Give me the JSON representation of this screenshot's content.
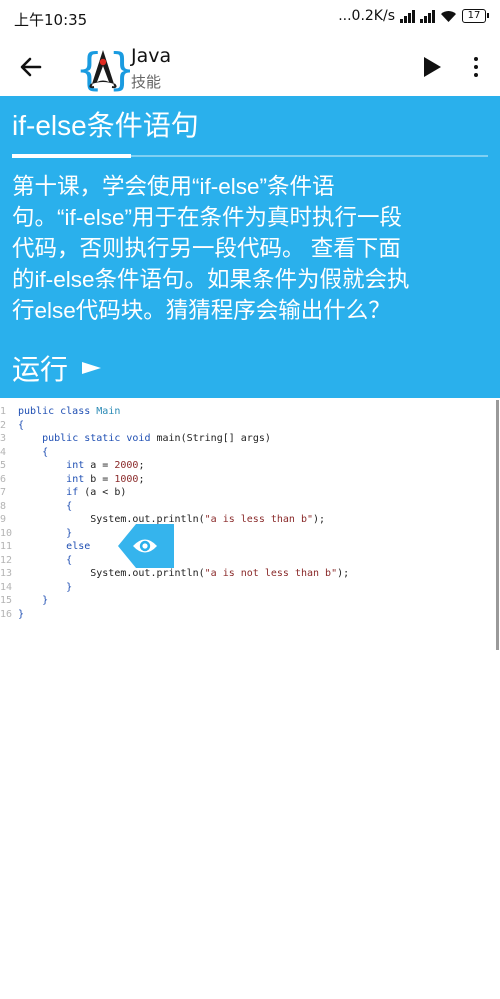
{
  "status_bar": {
    "time": "上午10:35",
    "network_speed": "...0.2K/s",
    "battery": "17"
  },
  "app_bar": {
    "title": "Java",
    "subtitle": "技能",
    "icons": {
      "back": "arrow-left-icon",
      "play": "play-icon",
      "more": "more-vert-icon",
      "logo": "java-duke-logo"
    }
  },
  "lesson": {
    "title": "if-else条件语句",
    "progress": 0.25,
    "lines": [
      "第十课，学会使用“if-else”条件语",
      "句。“if-else”用于在条件为真时执行一段",
      "代码，否则执行另一段代码。 查看下面",
      "的if-else条件语句。如果条件为假就会执",
      "行else代码块。猜猜程序会输出什么？"
    ],
    "run_label": "运行",
    "bg_color": "#2ab0ec"
  },
  "code": {
    "line_numbers": [
      "1",
      "2",
      "3",
      "4",
      "5",
      "6",
      "7",
      "8",
      "9",
      "10",
      "11",
      "12",
      "13",
      "14",
      "15",
      "16"
    ],
    "lines": [
      {
        "indent": "",
        "tokens": [
          {
            "t": "public class ",
            "c": "kw"
          },
          {
            "t": "Main",
            "c": "cls"
          }
        ]
      },
      {
        "indent": "",
        "tokens": [
          {
            "t": "{",
            "c": "kw"
          }
        ]
      },
      {
        "indent": "    ",
        "tokens": [
          {
            "t": "public static void ",
            "c": "kw"
          },
          {
            "t": "main(String[] args)",
            "c": ""
          }
        ]
      },
      {
        "indent": "    ",
        "tokens": [
          {
            "t": "{",
            "c": "kw"
          }
        ]
      },
      {
        "indent": "        ",
        "tokens": [
          {
            "t": "int ",
            "c": "kw"
          },
          {
            "t": "a = ",
            "c": ""
          },
          {
            "t": "2000",
            "c": "num"
          },
          {
            "t": ";",
            "c": ""
          }
        ]
      },
      {
        "indent": "        ",
        "tokens": [
          {
            "t": "int ",
            "c": "kw"
          },
          {
            "t": "b = ",
            "c": ""
          },
          {
            "t": "1000",
            "c": "num"
          },
          {
            "t": ";",
            "c": ""
          }
        ]
      },
      {
        "indent": "        ",
        "tokens": [
          {
            "t": "if ",
            "c": "kw"
          },
          {
            "t": "(a < b)",
            "c": ""
          }
        ]
      },
      {
        "indent": "        ",
        "tokens": [
          {
            "t": "{",
            "c": "kw"
          }
        ]
      },
      {
        "indent": "            ",
        "tokens": [
          {
            "t": "System.out.println(",
            "c": ""
          },
          {
            "t": "\"a is less than b\"",
            "c": "str"
          },
          {
            "t": ");",
            "c": ""
          }
        ]
      },
      {
        "indent": "        ",
        "tokens": [
          {
            "t": "}",
            "c": "kw"
          }
        ]
      },
      {
        "indent": "        ",
        "tokens": [
          {
            "t": "else",
            "c": "kw"
          }
        ]
      },
      {
        "indent": "        ",
        "tokens": [
          {
            "t": "{",
            "c": "kw"
          }
        ]
      },
      {
        "indent": "            ",
        "tokens": [
          {
            "t": "System.out.println(",
            "c": ""
          },
          {
            "t": "\"a is not less than b\"",
            "c": "str"
          },
          {
            "t": ");",
            "c": ""
          }
        ]
      },
      {
        "indent": "        ",
        "tokens": [
          {
            "t": "}",
            "c": "kw"
          }
        ]
      },
      {
        "indent": "    ",
        "tokens": [
          {
            "t": "}",
            "c": "kw"
          }
        ]
      },
      {
        "indent": "",
        "tokens": [
          {
            "t": "}",
            "c": "kw"
          }
        ]
      }
    ]
  },
  "eye_button": {
    "icon": "eye-icon",
    "color": "#2ab0ec"
  }
}
